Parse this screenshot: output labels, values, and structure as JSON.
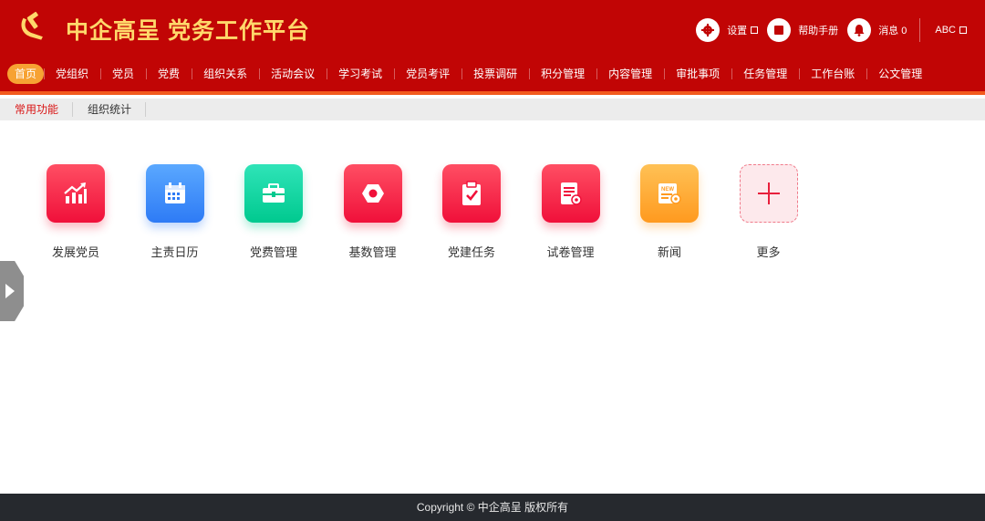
{
  "app": {
    "title": "中企高呈 党务工作平台",
    "logo": "party-emblem-icon"
  },
  "top_actions": {
    "settings": {
      "label": "设置",
      "icon": "gear-icon"
    },
    "manual": {
      "label": "帮助手册",
      "icon": "book-icon"
    },
    "messages": {
      "label": "消息 0",
      "icon": "bell-icon"
    },
    "user": {
      "label": "ABC"
    }
  },
  "nav": {
    "items": [
      "首页",
      "党组织",
      "党员",
      "党费",
      "组织关系",
      "活动会议",
      "学习考试",
      "党员考评",
      "投票调研",
      "积分管理",
      "内容管理",
      "审批事项",
      "任务管理",
      "工作台账",
      "公文管理"
    ],
    "active_index": 0
  },
  "subtabs": {
    "items": [
      "常用功能",
      "组织统计"
    ],
    "active_index": 0
  },
  "functions": [
    {
      "label": "发展党员",
      "icon": "growth-chart-icon",
      "color": "#f0103a"
    },
    {
      "label": "主责日历",
      "icon": "calendar-icon",
      "color": "#2e7bf5"
    },
    {
      "label": "党费管理",
      "icon": "briefcase-icon",
      "color": "#00c98f"
    },
    {
      "label": "基数管理",
      "icon": "hex-nut-icon",
      "color": "#f0103a"
    },
    {
      "label": "党建任务",
      "icon": "clipboard-check-icon",
      "color": "#f0103a"
    },
    {
      "label": "试卷管理",
      "icon": "document-gear-icon",
      "color": "#f0103a"
    },
    {
      "label": "新闻",
      "icon": "news-icon",
      "color": "#ff9a1f"
    },
    {
      "label": "更多",
      "icon": "plus-icon",
      "color": "#f07a8a"
    }
  ],
  "footer": {
    "copyright": "Copyright © 中企高呈 版权所有"
  },
  "colors": {
    "header": "#c10505",
    "accent_bar": "#f25a1d",
    "title": "#ffd86b",
    "active_nav": "#f7a233",
    "footer": "#26292e"
  }
}
